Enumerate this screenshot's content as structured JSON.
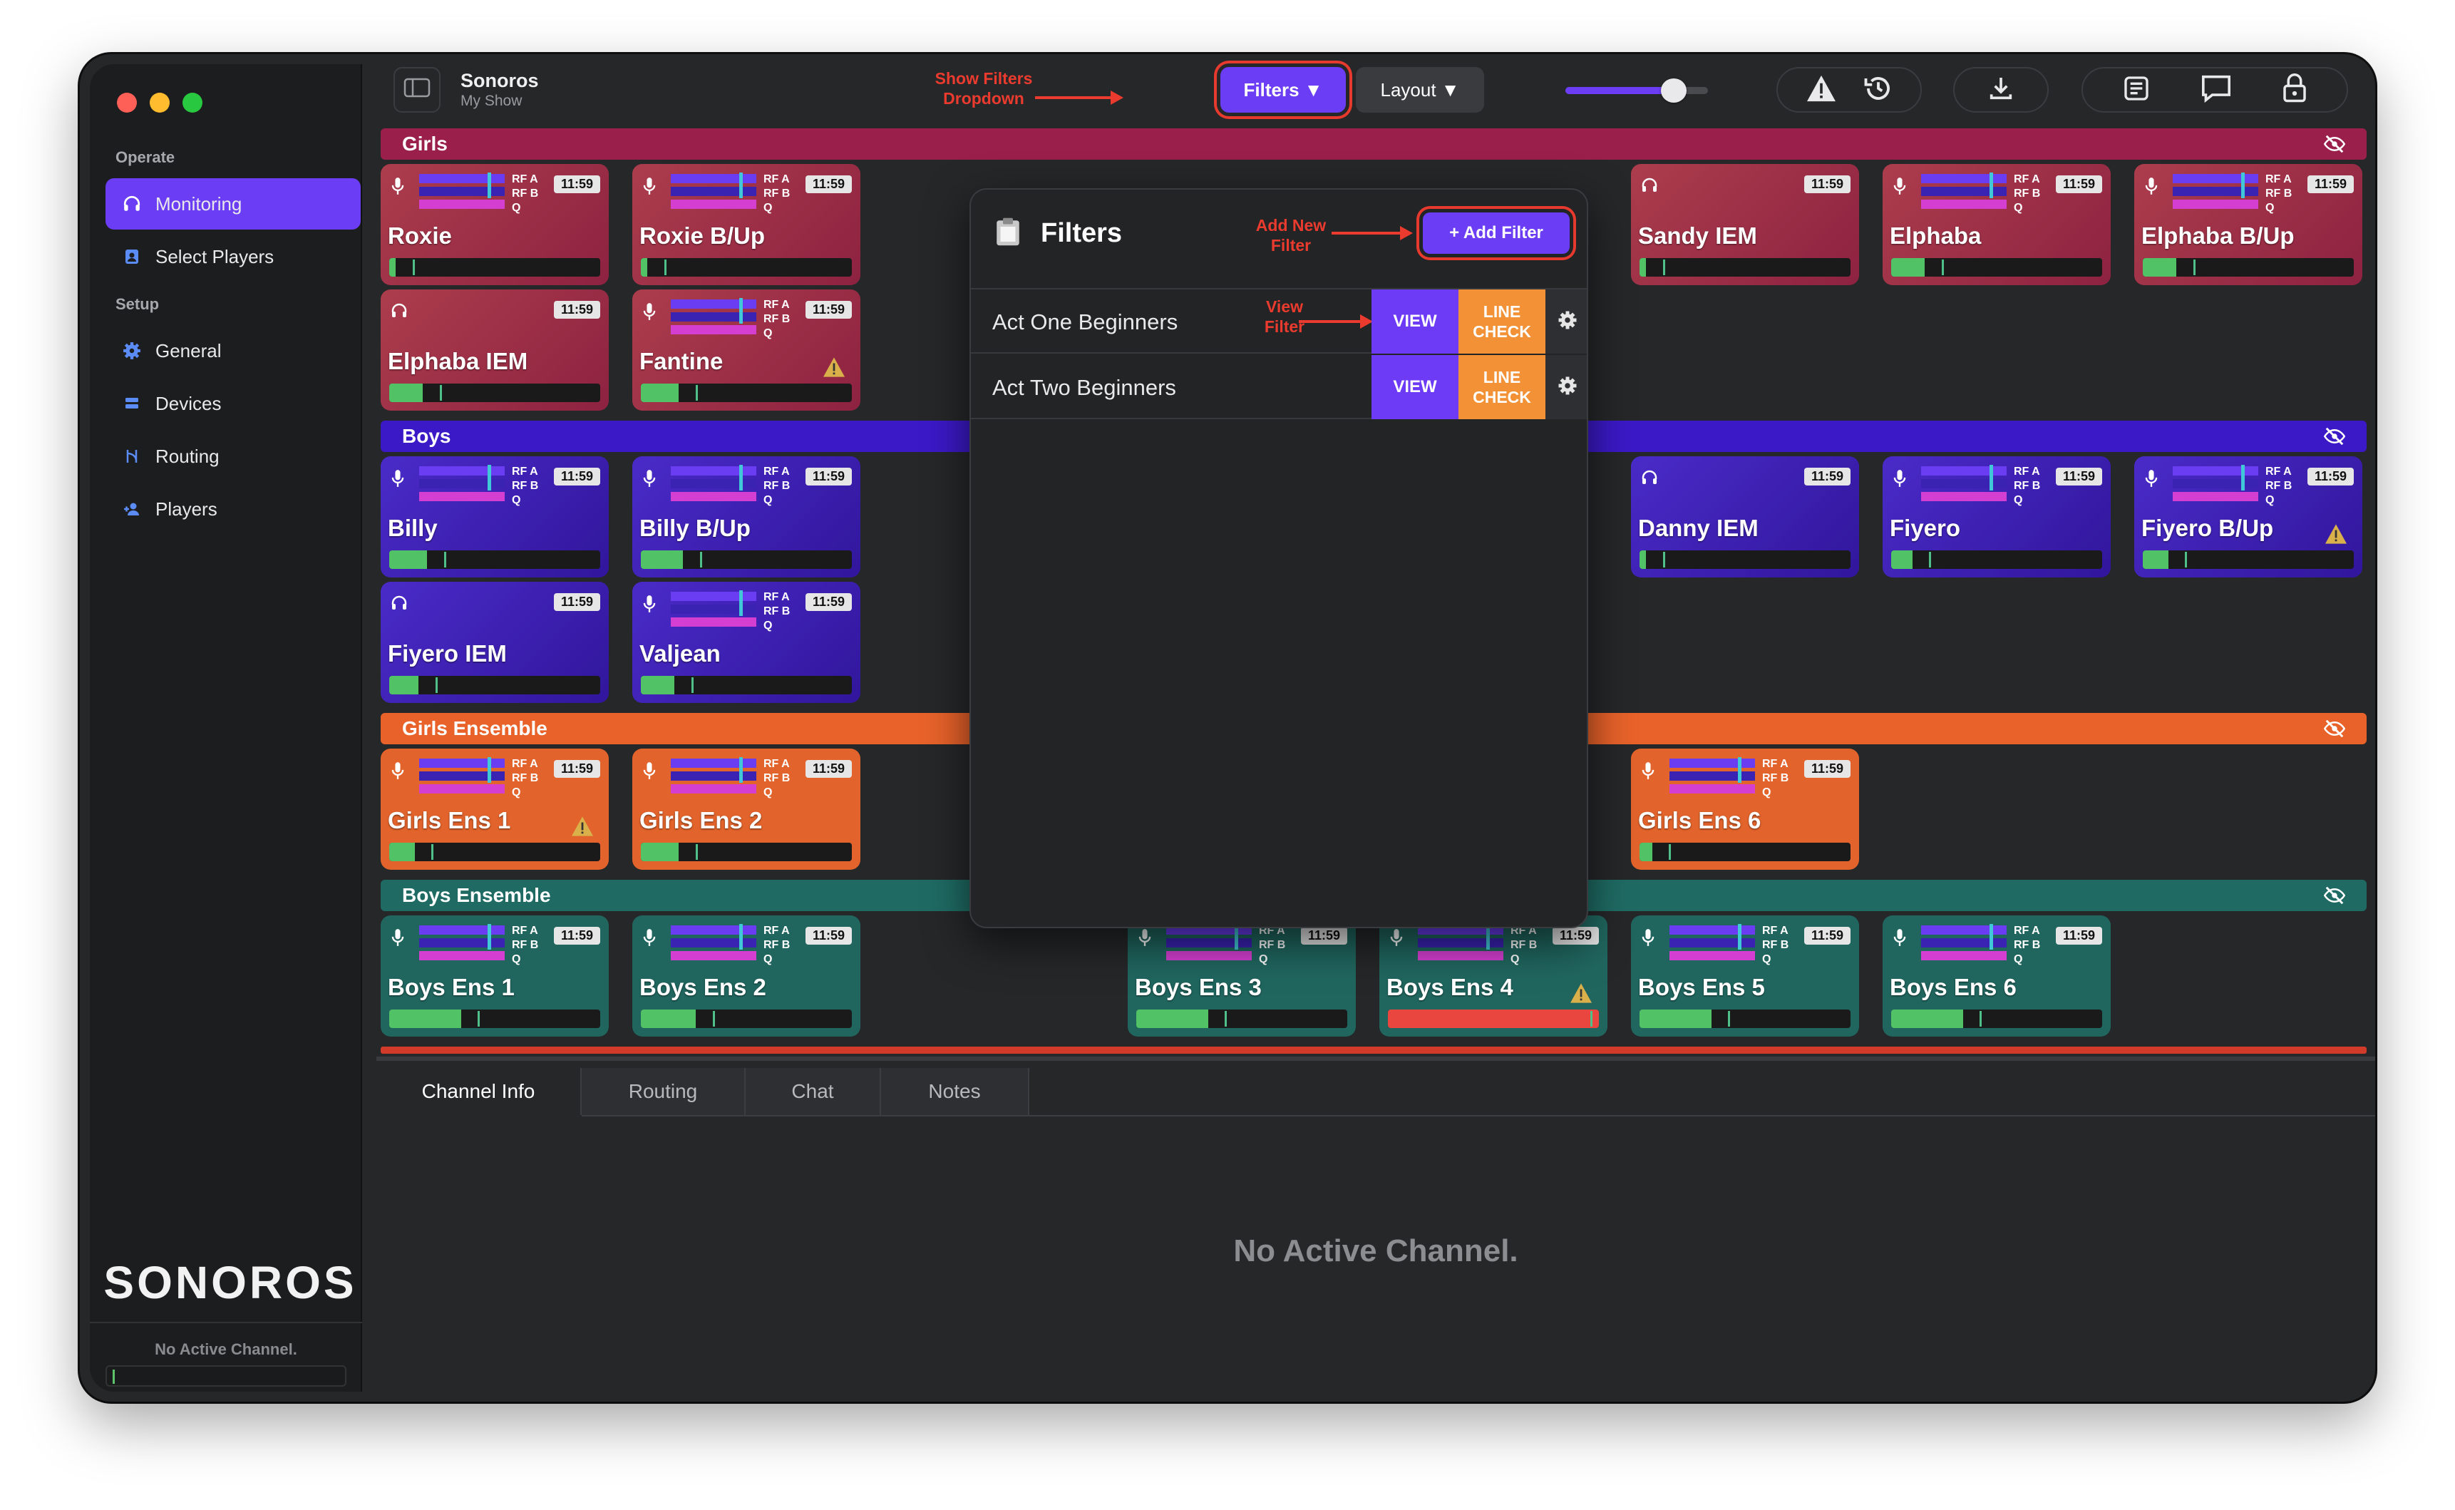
{
  "app": {
    "name": "Sonoros",
    "show": "My Show"
  },
  "sidebar": {
    "operate_label": "Operate",
    "setup_label": "Setup",
    "items": [
      {
        "label": "Monitoring",
        "icon": "headphones-icon",
        "active": true
      },
      {
        "label": "Select Players",
        "icon": "person-card-icon",
        "active": false
      },
      {
        "label": "General",
        "icon": "gear-icon",
        "active": false
      },
      {
        "label": "Devices",
        "icon": "devices-icon",
        "active": false
      },
      {
        "label": "Routing",
        "icon": "routing-icon",
        "active": false
      },
      {
        "label": "Players",
        "icon": "add-person-icon",
        "active": false
      }
    ],
    "logo": "SONOROS",
    "status": "No Active Channel."
  },
  "toolbar": {
    "filters_label": "Filters ▼",
    "layout_label": "Layout ▼",
    "volume": 0.75
  },
  "annotations": {
    "show_filters": "Show Filters\nDropdown",
    "add_new_filter": "Add New\nFilter",
    "view_filter": "View\nFilter"
  },
  "sections": [
    {
      "title": "Girls",
      "color": "#9a1f4a"
    },
    {
      "title": "Boys",
      "color": "#3b19c7"
    },
    {
      "title": "Girls Ensemble",
      "color": "#e8622a"
    },
    {
      "title": "Boys Ensemble",
      "color": "#1f6b64"
    }
  ],
  "channels": {
    "rfa": "RF A",
    "rfb": "RF B",
    "q": "Q",
    "time": "11:59",
    "girls": [
      {
        "name": "Roxie",
        "type": "mic",
        "level": 0.03
      },
      {
        "name": "Roxie B/Up",
        "type": "mic",
        "level": 0.03
      },
      {
        "name": "Sandy IEM",
        "type": "iem",
        "level": 0.03
      },
      {
        "name": "Elphaba",
        "type": "mic",
        "level": 0.16
      },
      {
        "name": "Elphaba B/Up",
        "type": "mic",
        "level": 0.16
      },
      {
        "name": "Elphaba IEM",
        "type": "iem",
        "level": 0.16
      },
      {
        "name": "Fantine",
        "type": "mic",
        "level": 0.18,
        "warn": true
      }
    ],
    "boys": [
      {
        "name": "Billy",
        "type": "mic",
        "level": 0.18
      },
      {
        "name": "Billy B/Up",
        "type": "mic",
        "level": 0.2
      },
      {
        "name": "Danny IEM",
        "type": "iem",
        "level": 0.03
      },
      {
        "name": "Fiyero",
        "type": "mic",
        "level": 0.1
      },
      {
        "name": "Fiyero B/Up",
        "type": "mic",
        "level": 0.12,
        "warn": true
      },
      {
        "name": "Fiyero IEM",
        "type": "iem",
        "level": 0.14
      },
      {
        "name": "Valjean",
        "type": "mic",
        "level": 0.16
      }
    ],
    "girls_ens": [
      {
        "name": "Girls Ens 1",
        "type": "mic",
        "level": 0.12,
        "warn": true
      },
      {
        "name": "Girls Ens 2",
        "type": "mic",
        "level": 0.18
      },
      {
        "name": "Girls Ens 6",
        "type": "mic",
        "level": 0.06
      }
    ],
    "boys_ens": [
      {
        "name": "Boys Ens 1",
        "type": "mic",
        "level": 0.34
      },
      {
        "name": "Boys Ens 2",
        "type": "mic",
        "level": 0.26
      },
      {
        "name": "Boys Ens 3",
        "type": "mic",
        "level": 0.34
      },
      {
        "name": "Boys Ens 4",
        "type": "mic",
        "level": 1.0,
        "warn": true,
        "clip": true
      },
      {
        "name": "Boys Ens 5",
        "type": "mic",
        "level": 0.34
      },
      {
        "name": "Boys Ens 6",
        "type": "mic",
        "level": 0.34
      }
    ]
  },
  "filters_dropdown": {
    "title": "Filters",
    "add_label": "+ Add Filter",
    "rows": [
      {
        "name": "Act One Beginners",
        "view": "VIEW",
        "line_check": "LINE CHECK"
      },
      {
        "name": "Act Two Beginners",
        "view": "VIEW",
        "line_check": "LINE CHECK"
      }
    ]
  },
  "bottom": {
    "tabs": [
      "Channel Info",
      "Routing",
      "Chat",
      "Notes"
    ],
    "empty": "No Active Channel."
  }
}
